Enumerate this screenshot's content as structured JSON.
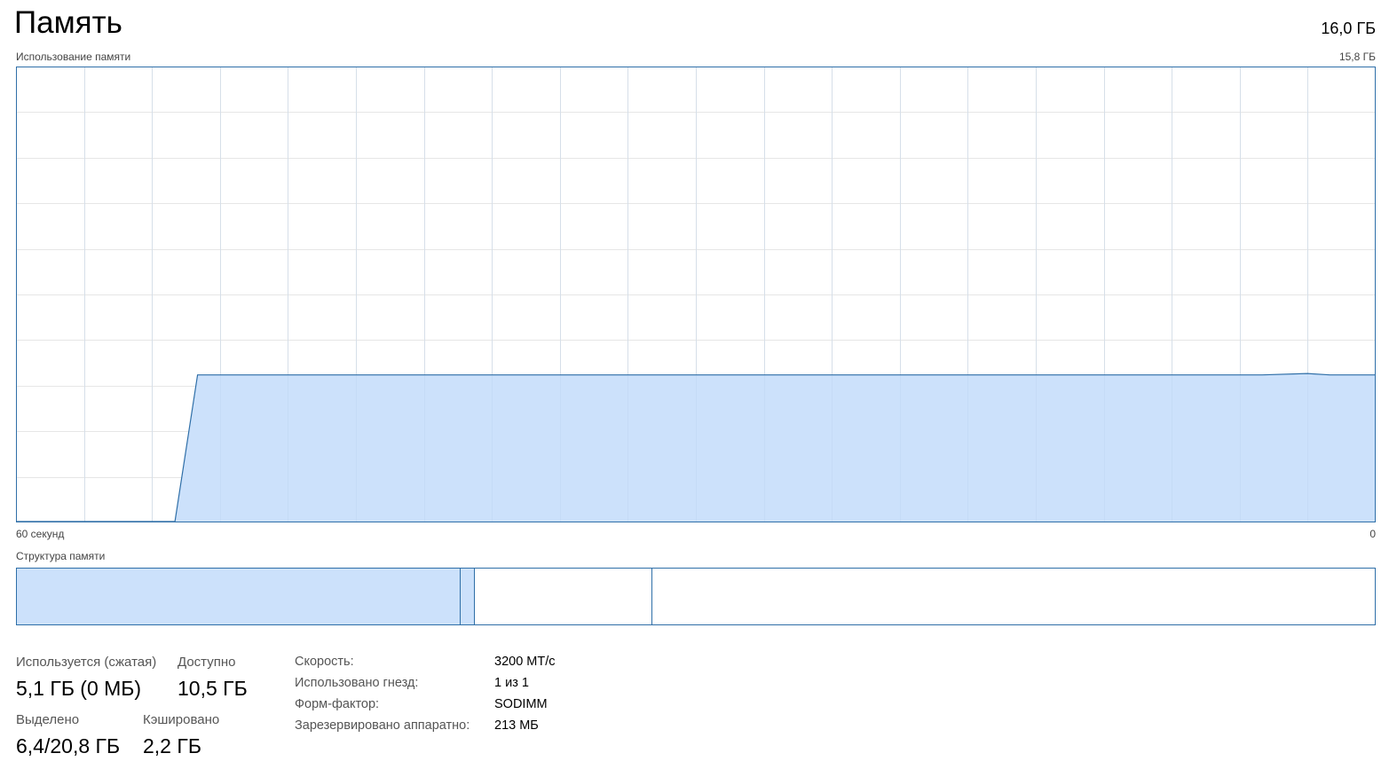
{
  "header": {
    "title": "Память",
    "total": "16,0 ГБ"
  },
  "chart_labels": {
    "usage_label": "Использование памяти",
    "usage_max": "15,8 ГБ",
    "time_start": "60 секунд",
    "time_end": "0",
    "structure_label": "Структура памяти"
  },
  "colors": {
    "fill": "#cce1fb",
    "line": "#2f6fa8",
    "grid": "#e6e6e6",
    "border": "#2f6fa8"
  },
  "chart_data": {
    "type": "area",
    "x": [
      60,
      53,
      52,
      50,
      45,
      40,
      38,
      35,
      30,
      25,
      20,
      15,
      12,
      10,
      5,
      3,
      2,
      0
    ],
    "values": [
      0,
      0,
      5.1,
      5.1,
      5.1,
      5.1,
      5.1,
      5.1,
      5.1,
      5.1,
      5.1,
      5.1,
      5.1,
      5.1,
      5.1,
      5.15,
      5.1,
      5.1
    ],
    "ylim": [
      0,
      15.8
    ],
    "xlim": [
      60,
      0
    ],
    "grid": true,
    "xlabel": "",
    "ylabel": ""
  },
  "structure": {
    "in_use_fraction": 0.326,
    "modified_fraction": 0.011,
    "standby_fraction": 0.131
  },
  "stats": {
    "in_use": {
      "label": "Используется (сжатая)",
      "value": "5,1 ГБ (0 МБ)"
    },
    "available": {
      "label": "Доступно",
      "value": "10,5 ГБ"
    },
    "committed": {
      "label": "Выделено",
      "value": "6,4/20,8 ГБ"
    },
    "cached": {
      "label": "Кэшировано",
      "value": "2,2 ГБ"
    }
  },
  "details": [
    {
      "label": "Скорость:",
      "value": "3200 МТ/с"
    },
    {
      "label": "Использовано гнезд:",
      "value": "1 из 1"
    },
    {
      "label": "Форм-фактор:",
      "value": "SODIMM"
    },
    {
      "label": "Зарезервировано аппаратно:",
      "value": "213 МБ"
    }
  ]
}
